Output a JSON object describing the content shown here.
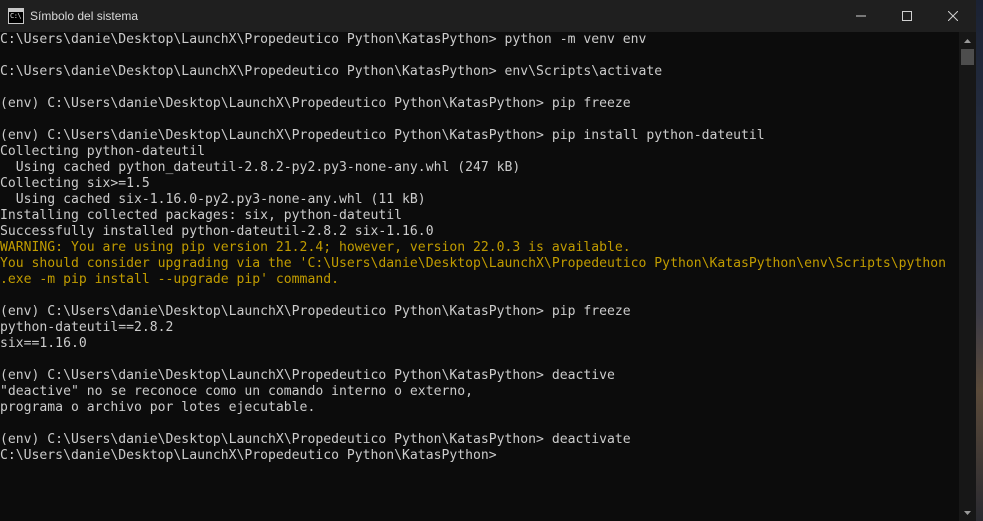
{
  "window": {
    "title": "Símbolo del sistema",
    "icon": "cmd-icon",
    "icon_text": "C:\\"
  },
  "controls": {
    "minimize": "minimize-icon",
    "maximize": "maximize-icon",
    "close": "close-icon"
  },
  "console": {
    "lines": [
      {
        "text": "C:\\Users\\danie\\Desktop\\LaunchX\\Propedeutico Python\\KatasPython> python -m venv env",
        "color": "#cccccc"
      },
      {
        "text": "",
        "color": "#cccccc"
      },
      {
        "text": "C:\\Users\\danie\\Desktop\\LaunchX\\Propedeutico Python\\KatasPython> env\\Scripts\\activate",
        "color": "#cccccc"
      },
      {
        "text": "",
        "color": "#cccccc"
      },
      {
        "text": "(env) C:\\Users\\danie\\Desktop\\LaunchX\\Propedeutico Python\\KatasPython> pip freeze",
        "color": "#cccccc"
      },
      {
        "text": "",
        "color": "#cccccc"
      },
      {
        "text": "(env) C:\\Users\\danie\\Desktop\\LaunchX\\Propedeutico Python\\KatasPython> pip install python-dateutil",
        "color": "#cccccc"
      },
      {
        "text": "Collecting python-dateutil",
        "color": "#cccccc"
      },
      {
        "text": "  Using cached python_dateutil-2.8.2-py2.py3-none-any.whl (247 kB)",
        "color": "#cccccc"
      },
      {
        "text": "Collecting six>=1.5",
        "color": "#cccccc"
      },
      {
        "text": "  Using cached six-1.16.0-py2.py3-none-any.whl (11 kB)",
        "color": "#cccccc"
      },
      {
        "text": "Installing collected packages: six, python-dateutil",
        "color": "#cccccc"
      },
      {
        "text": "Successfully installed python-dateutil-2.8.2 six-1.16.0",
        "color": "#cccccc"
      },
      {
        "text": "WARNING: You are using pip version 21.2.4; however, version 22.0.3 is available.",
        "color": "#c19c00"
      },
      {
        "text": "You should consider upgrading via the 'C:\\Users\\danie\\Desktop\\LaunchX\\Propedeutico Python\\KatasPython\\env\\Scripts\\python",
        "color": "#c19c00"
      },
      {
        "text": ".exe -m pip install --upgrade pip' command.",
        "color": "#c19c00"
      },
      {
        "text": "",
        "color": "#cccccc"
      },
      {
        "text": "(env) C:\\Users\\danie\\Desktop\\LaunchX\\Propedeutico Python\\KatasPython> pip freeze",
        "color": "#cccccc"
      },
      {
        "text": "python-dateutil==2.8.2",
        "color": "#cccccc"
      },
      {
        "text": "six==1.16.0",
        "color": "#cccccc"
      },
      {
        "text": "",
        "color": "#cccccc"
      },
      {
        "text": "(env) C:\\Users\\danie\\Desktop\\LaunchX\\Propedeutico Python\\KatasPython> deactive",
        "color": "#cccccc"
      },
      {
        "text": "\"deactive\" no se reconoce como un comando interno o externo,",
        "color": "#cccccc"
      },
      {
        "text": "programa o archivo por lotes ejecutable.",
        "color": "#cccccc"
      },
      {
        "text": "",
        "color": "#cccccc"
      },
      {
        "text": "(env) C:\\Users\\danie\\Desktop\\LaunchX\\Propedeutico Python\\KatasPython> deactivate",
        "color": "#cccccc"
      },
      {
        "text": "C:\\Users\\danie\\Desktop\\LaunchX\\Propedeutico Python\\KatasPython>",
        "color": "#cccccc"
      }
    ]
  },
  "scrollbar": {
    "up": "scroll-up-arrow-icon",
    "down": "scroll-down-arrow-icon",
    "position": 0.0
  }
}
